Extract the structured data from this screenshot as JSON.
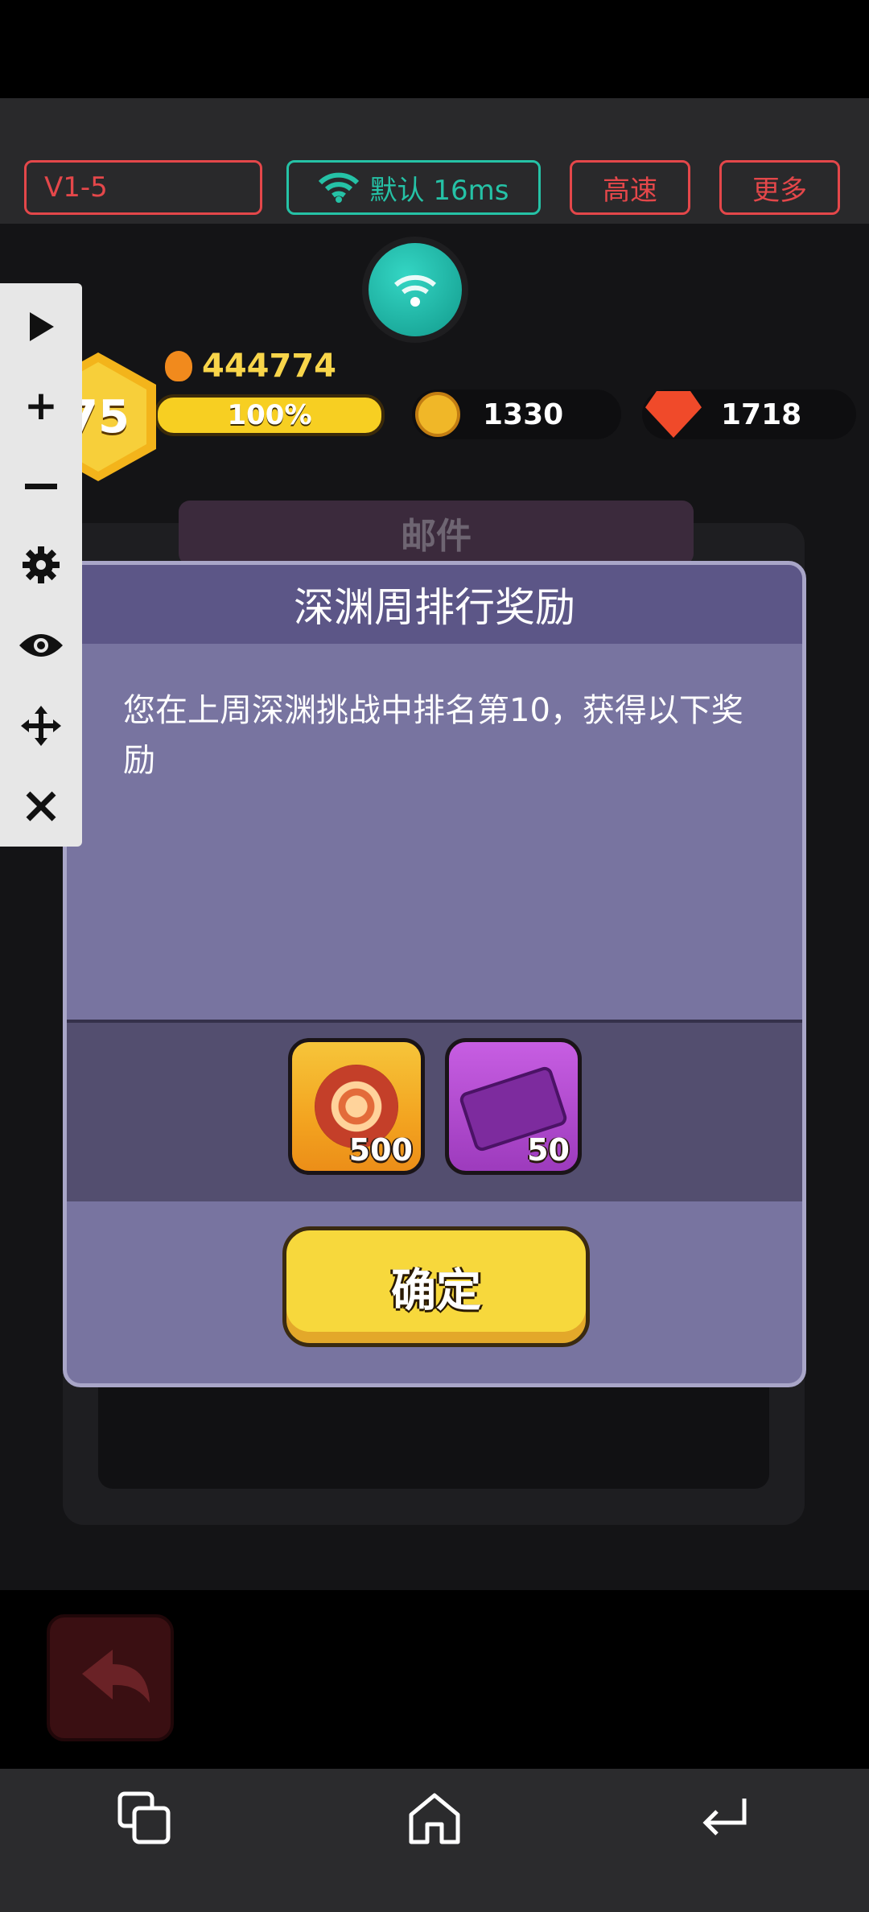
{
  "toolbar": {
    "version": "V1-5",
    "network": "默认 16ms",
    "speed": "高速",
    "more": "更多"
  },
  "hud": {
    "level": "75",
    "power": "444774",
    "xp_percent": "100%",
    "coins": "1330",
    "gems": "1718"
  },
  "background": {
    "mail_title": "邮件"
  },
  "dialog": {
    "title": "深渊周排行奖励",
    "message": "您在上周深渊挑战中排名第10，获得以下奖励",
    "rewards": [
      {
        "icon": "orb-icon",
        "qty": "500"
      },
      {
        "icon": "ticket-icon",
        "qty": "50"
      }
    ],
    "confirm": "确定"
  },
  "side_panel": {
    "items": [
      "play-icon",
      "plus-icon",
      "minus-icon",
      "gear-icon",
      "eye-icon",
      "move-icon",
      "close-icon"
    ]
  },
  "nav": {
    "items": [
      "recents-icon",
      "home-icon",
      "back-icon"
    ]
  },
  "colors": {
    "toolbar_red": "#e4474a",
    "toolbar_teal": "#25c2a6",
    "dialog_body": "#7874a0",
    "dialog_header": "#5c5687",
    "button_yellow": "#f7d83c"
  }
}
